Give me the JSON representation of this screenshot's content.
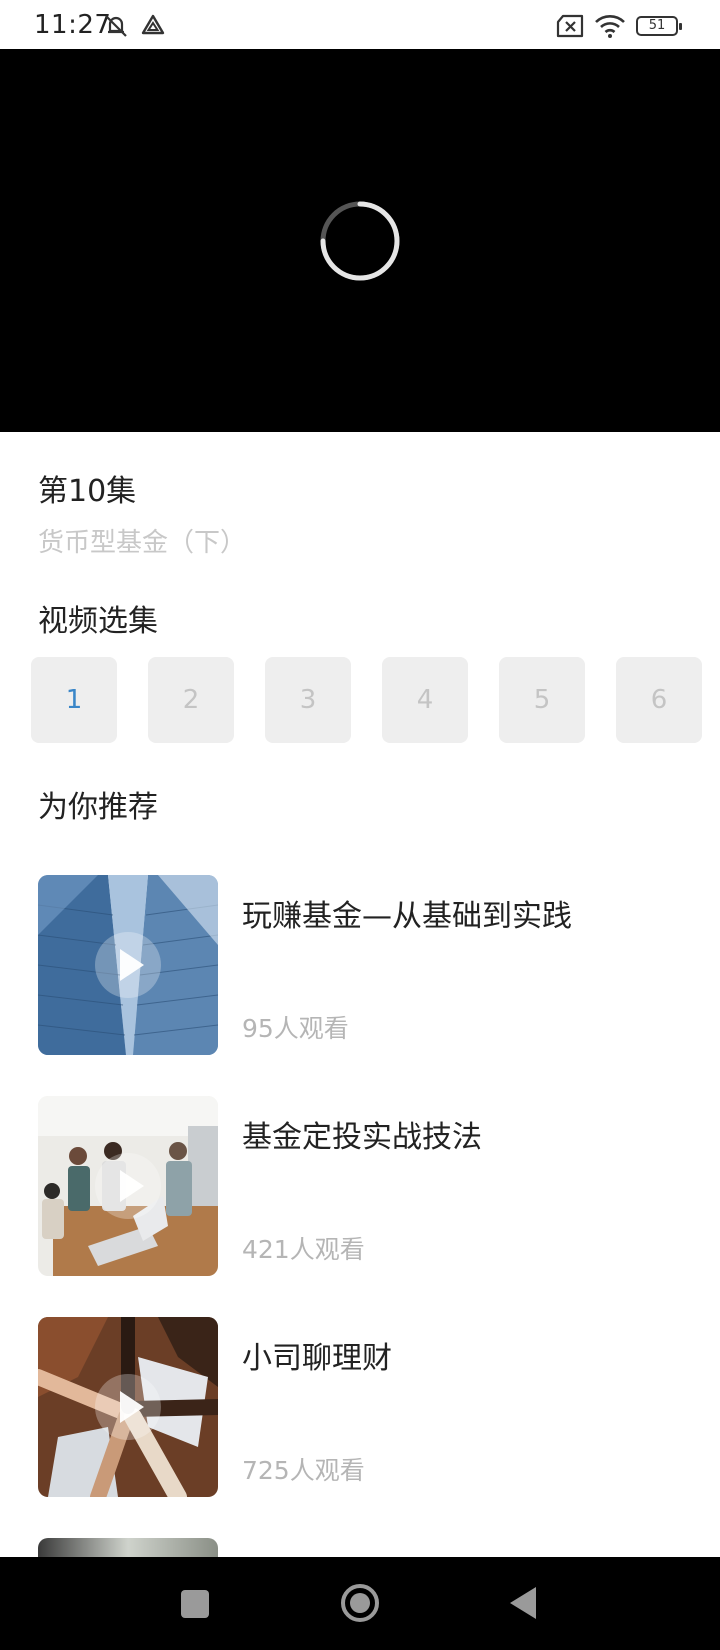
{
  "status_bar": {
    "time": "11:27",
    "battery": "51"
  },
  "episode": {
    "title": "第10集",
    "subtitle": "货币型基金（下）"
  },
  "episodes_section": {
    "title": "视频选集",
    "items": [
      "1",
      "2",
      "3",
      "4",
      "5",
      "6"
    ],
    "selected": "1"
  },
  "recommend_section": {
    "title": "为你推荐",
    "items": [
      {
        "title": "玩赚基金—从基础到实践",
        "views": "95人观看"
      },
      {
        "title": "基金定投实战技法",
        "views": "421人观看"
      },
      {
        "title": "小司聊理财",
        "views": "725人观看"
      }
    ]
  },
  "colors": {
    "accent": "#3a86c8",
    "muted_text": "#b5b5b5",
    "episode_bg": "#eeeeee"
  }
}
